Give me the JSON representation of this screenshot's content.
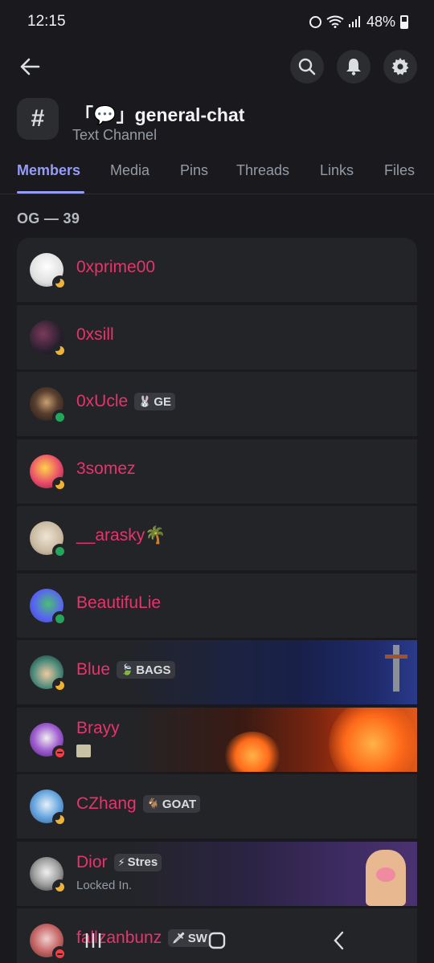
{
  "status_bar": {
    "time": "12:15",
    "battery": "48%"
  },
  "channel": {
    "title": "「💬」general-chat",
    "subtitle": "Text Channel",
    "icon_glyph": "#"
  },
  "tabs": [
    {
      "label": "Members",
      "active": true
    },
    {
      "label": "Media"
    },
    {
      "label": "Pins"
    },
    {
      "label": "Threads"
    },
    {
      "label": "Links"
    },
    {
      "label": "Files"
    }
  ],
  "section": {
    "label": "OG — 39"
  },
  "members": [
    {
      "name": "0xprime00",
      "status": "idle",
      "avatar_color": "#e6e6e6"
    },
    {
      "name": "0xsill",
      "status": "idle",
      "avatar_color": "#3a2a3a"
    },
    {
      "name": "0xUcle",
      "status": "online",
      "avatar_color": "#3b2f25",
      "tag": {
        "emoji": "🐰",
        "text": "GE"
      }
    },
    {
      "name": "3somez",
      "status": "idle",
      "avatar_color": "#e8567a"
    },
    {
      "name": "__arasky🌴",
      "status": "online",
      "avatar_color": "#c8b8a0"
    },
    {
      "name": "BeautifuLie",
      "status": "online",
      "avatar_color": "#5865f2"
    },
    {
      "name": "Blue",
      "status": "idle",
      "avatar_color": "#4a8a7a",
      "tag": {
        "emoji": "🍃",
        "text": "BAGS"
      },
      "banner": "night"
    },
    {
      "name": "Brayy",
      "status": "dnd",
      "avatar_color": "#7a3aa8",
      "banner": "fire"
    },
    {
      "name": "CZhang",
      "status": "idle",
      "avatar_color": "#3a7ab8",
      "tag": {
        "emoji": "🐐",
        "text": "GOAT"
      }
    },
    {
      "name": "Dior",
      "status": "idle",
      "avatar_color": "#d0d0d0",
      "tag": {
        "emoji": "⚡",
        "text": "Stres"
      },
      "subtext": "Locked In.",
      "banner": "purple"
    },
    {
      "name": "fallzanbunz",
      "status": "dnd",
      "avatar_color": "#b85a5a",
      "tag": {
        "emoji": "🗡",
        "text": "SW"
      }
    }
  ],
  "icons": {
    "back": "back-arrow-icon",
    "search": "search-icon",
    "bell": "bell-icon",
    "settings": "gear-icon"
  }
}
